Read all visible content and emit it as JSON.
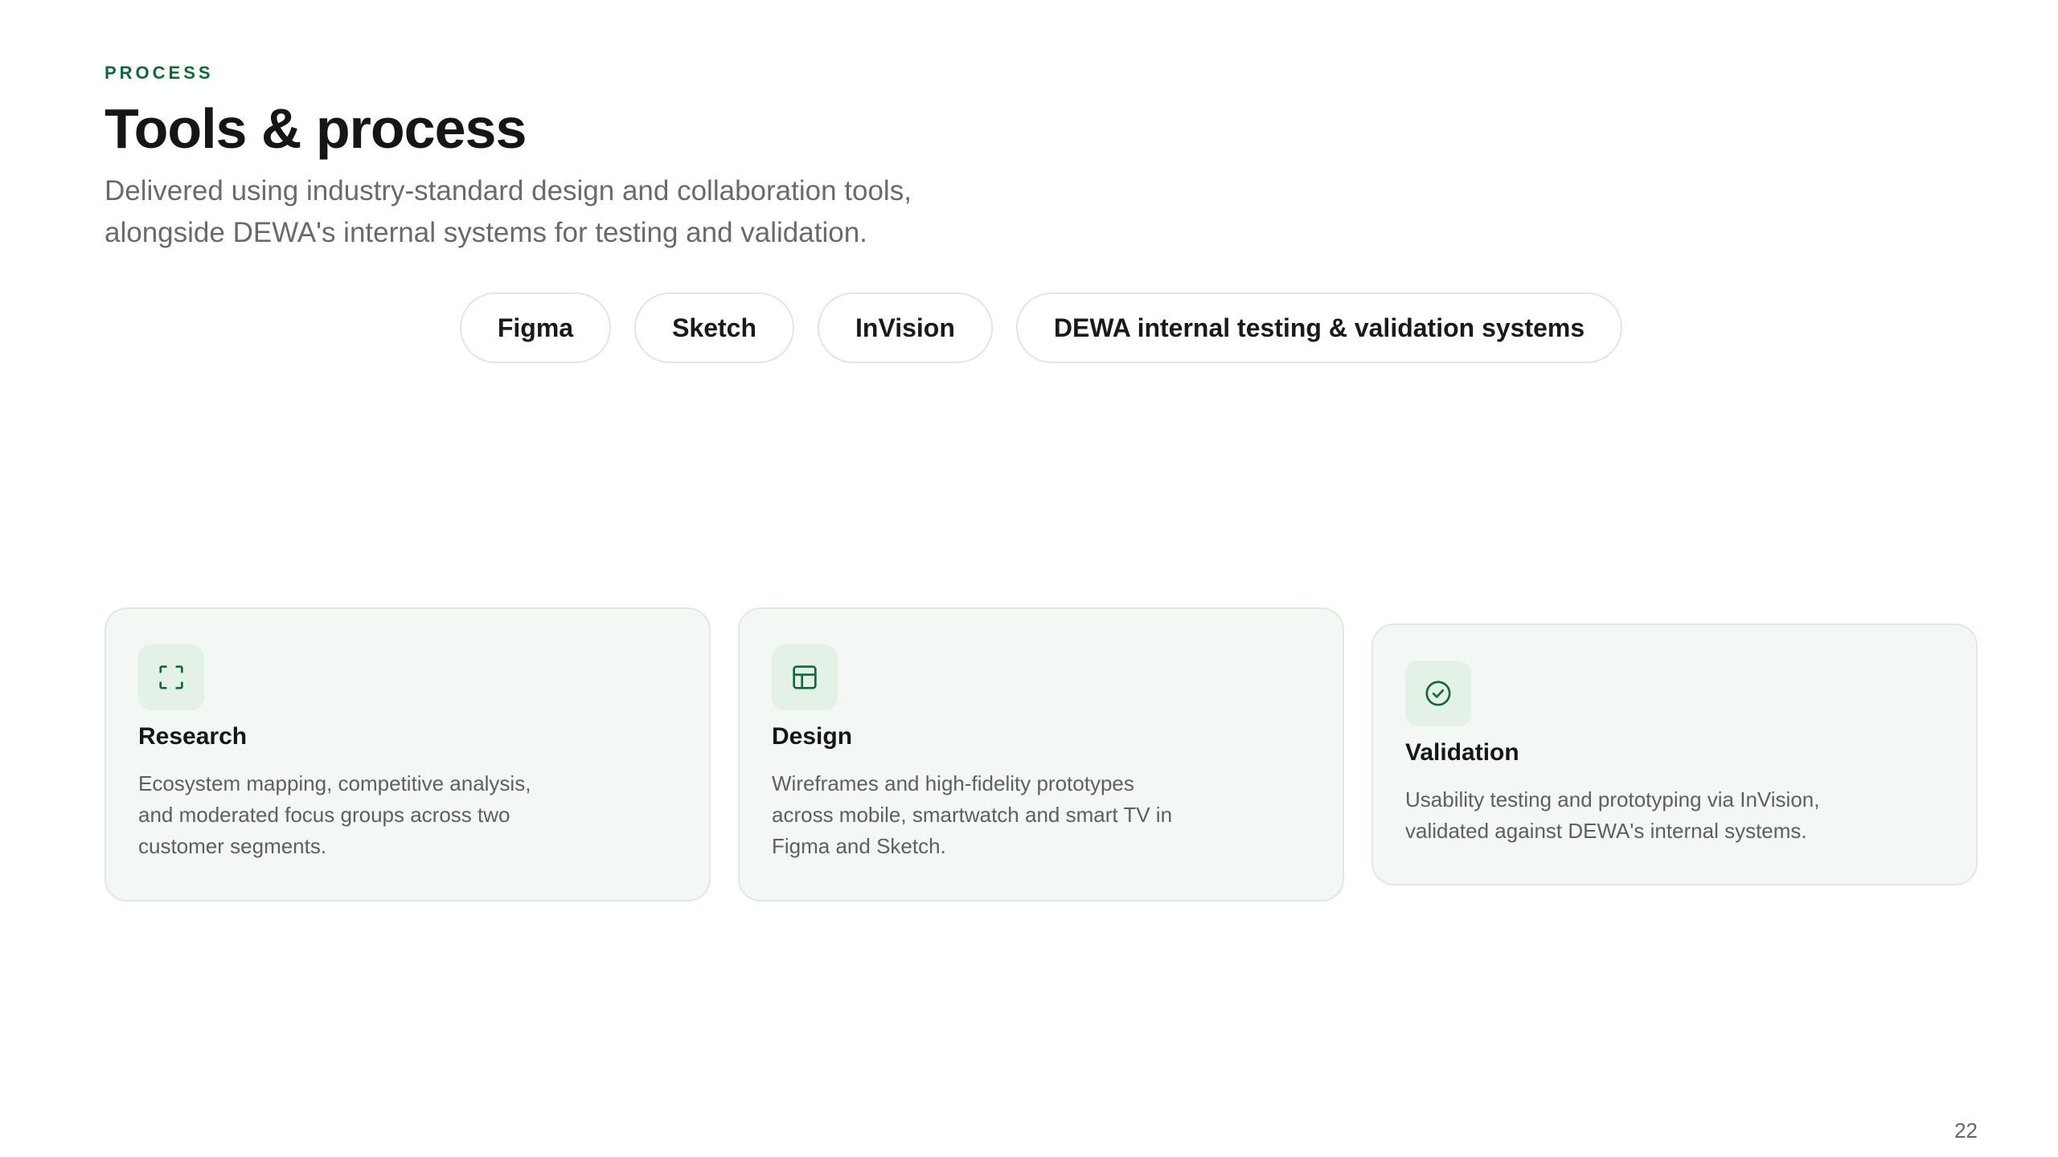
{
  "header": {
    "eyebrow": "PROCESS",
    "title": "Tools & process",
    "subtitle": "Delivered using industry-standard design and collaboration tools, alongside DEWA's internal systems for testing and validation."
  },
  "tools": [
    {
      "label": "Figma"
    },
    {
      "label": "Sketch"
    },
    {
      "label": "InVision"
    },
    {
      "label": "DEWA internal testing & validation systems"
    }
  ],
  "cards": [
    {
      "icon": "focus-frame-icon",
      "title": "Research",
      "text": "Ecosystem mapping, competitive analysis, and moderated focus groups across two customer segments."
    },
    {
      "icon": "layout-icon",
      "title": "Design",
      "text": "Wireframes and high-fidelity prototypes across mobile, smartwatch and smart TV in Figma and Sketch."
    },
    {
      "icon": "check-circle-icon",
      "title": "Validation",
      "text": "Usability testing and prototyping via InVision, validated against DEWA's internal systems."
    }
  ],
  "footer": {
    "page_number": "22"
  },
  "colors": {
    "accent": "#0f6b35",
    "card_background": "#f3f8f4",
    "card_border": "#dde9e1",
    "icon_background": "#e3f1e7"
  }
}
